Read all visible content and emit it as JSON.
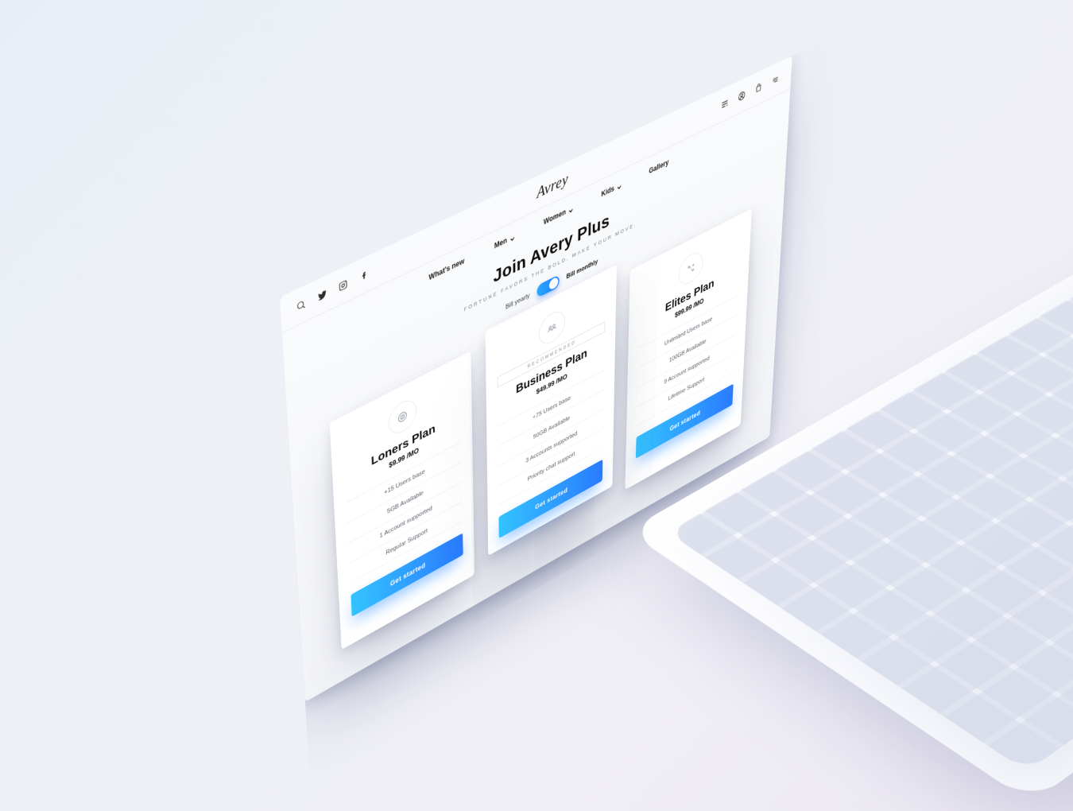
{
  "brand": "Avrey",
  "nav": {
    "items": [
      {
        "label": "What's new",
        "dropdown": false
      },
      {
        "label": "Men",
        "dropdown": true
      },
      {
        "label": "Women",
        "dropdown": true
      },
      {
        "label": "Kids",
        "dropdown": true
      },
      {
        "label": "Gallery",
        "dropdown": false
      }
    ]
  },
  "hero": {
    "title": "Join Avery Plus",
    "subtitle": "FORTUNE FAVORS THE BOLD, MAKE YOUR MOVE.",
    "bill_yearly_label": "Bill yearly",
    "bill_monthly_label": "Bill monthly",
    "toggle_state": "monthly"
  },
  "plans": [
    {
      "icon": "target-icon",
      "badge": null,
      "name": "Loners Plan",
      "price": "$9.99 /MO",
      "features": [
        "+15 Users base",
        "5GB Available",
        "1 Account supported",
        "Regular Support"
      ],
      "cta": "Get started",
      "featured": false
    },
    {
      "icon": "users-icon",
      "badge": "RECOMMENDED",
      "name": "Business Plan",
      "price": "$49.99 /MO",
      "features": [
        "+75 Users base",
        "50GB Available",
        "3 Accounts supported",
        "Priority chat support"
      ],
      "cta": "Get started",
      "featured": true
    },
    {
      "icon": "strategy-icon",
      "badge": null,
      "name": "Elites Plan",
      "price": "$99.99 /MO",
      "features": [
        "Unlimited Users base",
        "100GB Available",
        "9 Account supported",
        "Lifetime Support"
      ],
      "cta": "Get started",
      "featured": false
    }
  ]
}
